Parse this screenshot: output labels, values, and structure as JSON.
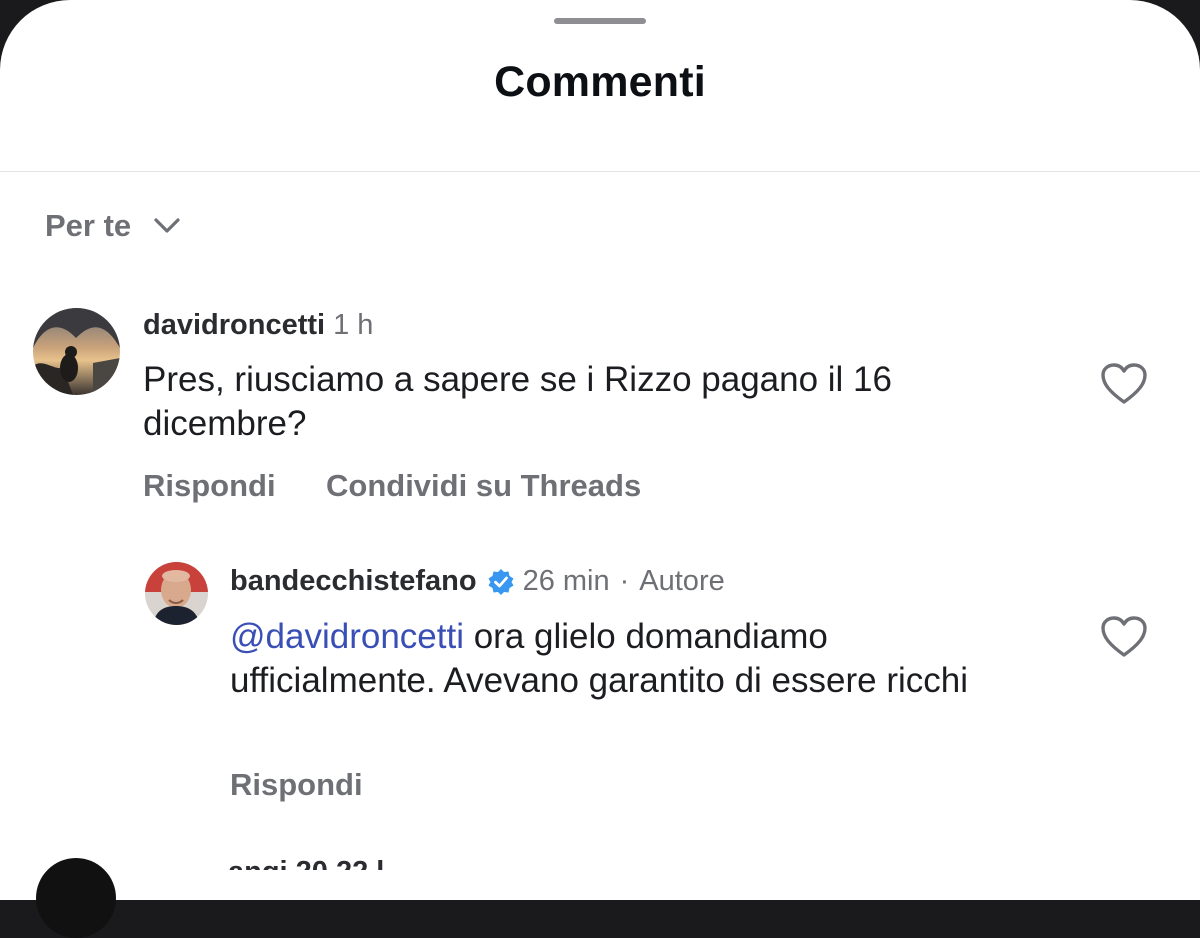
{
  "sheet": {
    "title": "Commenti",
    "sort_label": "Per te"
  },
  "comments": [
    {
      "username": "davidroncetti",
      "time": "1 h",
      "text": "Pres, riusciamo a sapere se i Rizzo pagano il 16 dicembre?",
      "actions": [
        "Rispondi",
        "Condividi su Threads"
      ]
    }
  ],
  "reply": {
    "username": "bandecchistefano",
    "verified": true,
    "time": "26 min",
    "separator": "·",
    "role": "Autore",
    "mention": "@davidroncetti",
    "text": " ora glielo domandiamo ufficialmente. Avevano garantito di essere ricchi",
    "action": "Rispondi"
  },
  "next_comment_peek": {
    "username_partial": "angi 20 22 l"
  },
  "colors": {
    "verified_badge": "#3897f0",
    "mention": "#3a4fb5",
    "secondary_text": "#6e7075"
  },
  "icons": [
    "chevron-down-icon",
    "heart-icon",
    "verified-badge-icon"
  ]
}
